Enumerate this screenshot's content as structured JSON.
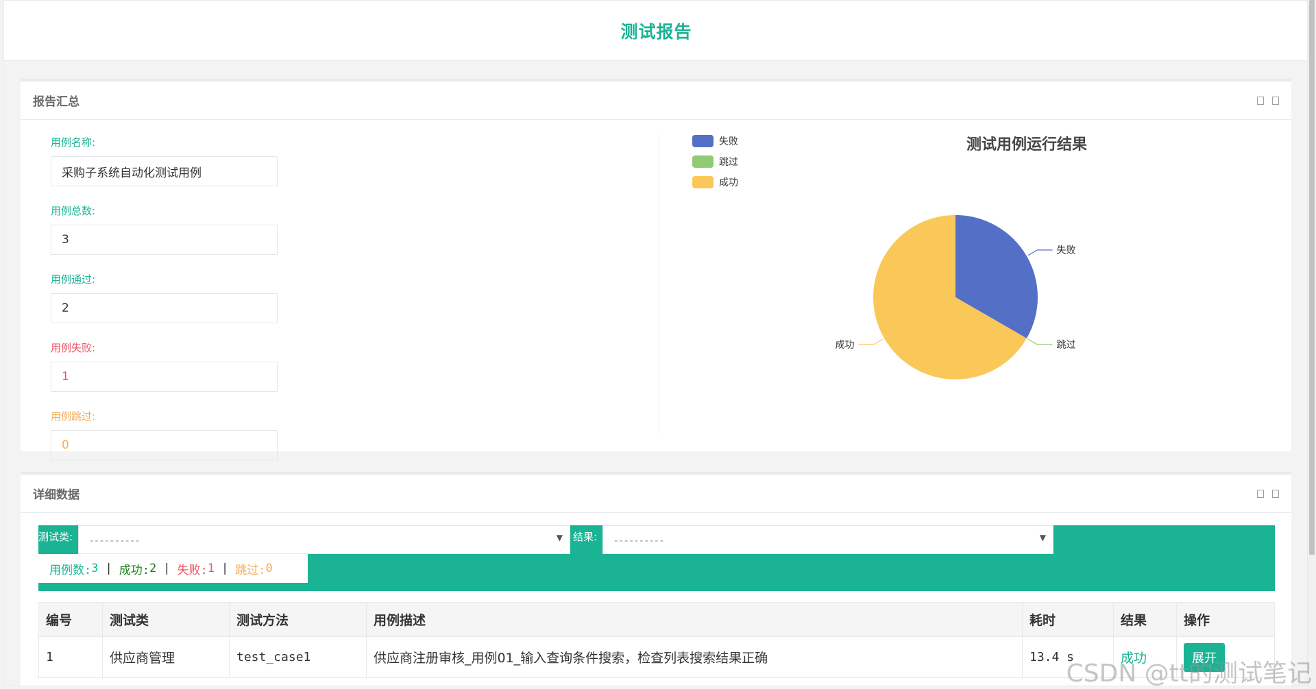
{
  "header": {
    "title": "测试报告"
  },
  "summary": {
    "title": "报告汇总",
    "fields": {
      "name": {
        "label": "用例名称:",
        "value": "采购子系统自动化测试用例"
      },
      "total": {
        "label": "用例总数:",
        "value": "3"
      },
      "pass": {
        "label": "用例通过:",
        "value": "2"
      },
      "fail": {
        "label": "用例失败:",
        "value": "1"
      },
      "skip": {
        "label": "用例跳过:",
        "value": "0"
      }
    }
  },
  "chart_data": {
    "type": "pie",
    "title": "测试用例运行结果",
    "categories": [
      "失败",
      "跳过",
      "成功"
    ],
    "values": [
      1,
      0,
      2
    ],
    "colors": [
      "#5470c6",
      "#91cc75",
      "#fac858"
    ],
    "legend_position": "top-left"
  },
  "details": {
    "title": "详细数据",
    "filters": {
      "class_label": "测试类:",
      "class_placeholder": "----------",
      "result_label": "结果:",
      "result_placeholder": "----------"
    },
    "stats": {
      "total_label": "用例数:",
      "total": "3",
      "success_label": "成功:",
      "success": "2",
      "fail_label": "失败:",
      "fail": "1",
      "skip_label": "跳过:",
      "skip": "0"
    },
    "table": {
      "headers": [
        "编号",
        "测试类",
        "测试方法",
        "用例描述",
        "耗时",
        "结果",
        "操作"
      ],
      "rows": [
        {
          "id": "1",
          "class": "供应商管理",
          "method": "test_case1",
          "desc": "供应商注册审核_用例01_输入查询条件搜索，检查列表搜索结果正确",
          "time": "13.4 s",
          "result": "成功",
          "action": "展开"
        }
      ]
    }
  },
  "watermark": "CSDN @tt的测试笔记",
  "colors": {
    "accent": "#1ab394",
    "danger": "#ed5565",
    "warning": "#f8ac59",
    "success_text": "#1c84c6"
  }
}
